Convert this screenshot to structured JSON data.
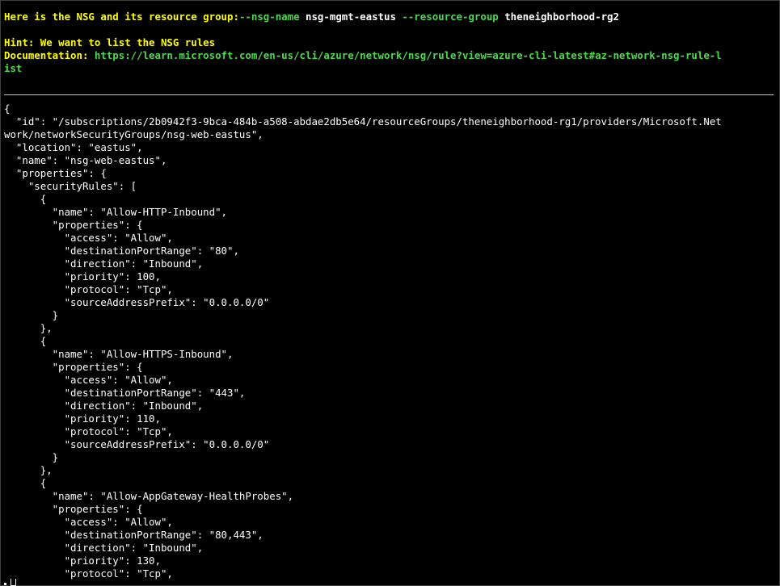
{
  "header": {
    "intro_label": "Here is the NSG and its resource group:",
    "nsg_flag": "--nsg-name",
    "nsg_value": "nsg-mgmt-eastus",
    "rg_flag": "--resource-group",
    "rg_value": "theneighborhood-rg2",
    "hint": "Hint: We want to list the NSG rules",
    "doc_label": "Documentation:",
    "doc_url_line1": "https://learn.microsoft.com/en-us/cli/azure/network/nsg/rule?view=azure-cli-latest#az-network-nsg-rule-l",
    "doc_url_line2": "ist"
  },
  "colors": {
    "background": "#000000",
    "yellow": "#ffff00",
    "green": "#4dd84d",
    "text": "#ffffff"
  },
  "output_lines": [
    "{",
    "  \"id\": \"/subscriptions/2b0942f3-9bca-484b-a508-abdae2db5e64/resourceGroups/theneighborhood-rg1/providers/Microsoft.Net",
    "work/networkSecurityGroups/nsg-web-eastus\",",
    "  \"location\": \"eastus\",",
    "  \"name\": \"nsg-web-eastus\",",
    "  \"properties\": {",
    "    \"securityRules\": [",
    "      {",
    "        \"name\": \"Allow-HTTP-Inbound\",",
    "        \"properties\": {",
    "          \"access\": \"Allow\",",
    "          \"destinationPortRange\": \"80\",",
    "          \"direction\": \"Inbound\",",
    "          \"priority\": 100,",
    "          \"protocol\": \"Tcp\",",
    "          \"sourceAddressPrefix\": \"0.0.0.0/0\"",
    "        }",
    "      },",
    "      {",
    "        \"name\": \"Allow-HTTPS-Inbound\",",
    "        \"properties\": {",
    "          \"access\": \"Allow\",",
    "          \"destinationPortRange\": \"443\",",
    "          \"direction\": \"Inbound\",",
    "          \"priority\": 110,",
    "          \"protocol\": \"Tcp\",",
    "          \"sourceAddressPrefix\": \"0.0.0.0/0\"",
    "        }",
    "      },",
    "      {",
    "        \"name\": \"Allow-AppGateway-HealthProbes\",",
    "        \"properties\": {",
    "          \"access\": \"Allow\",",
    "          \"destinationPortRange\": \"80,443\",",
    "          \"direction\": \"Inbound\",",
    "          \"priority\": 130,",
    "          \"protocol\": \"Tcp\","
  ]
}
